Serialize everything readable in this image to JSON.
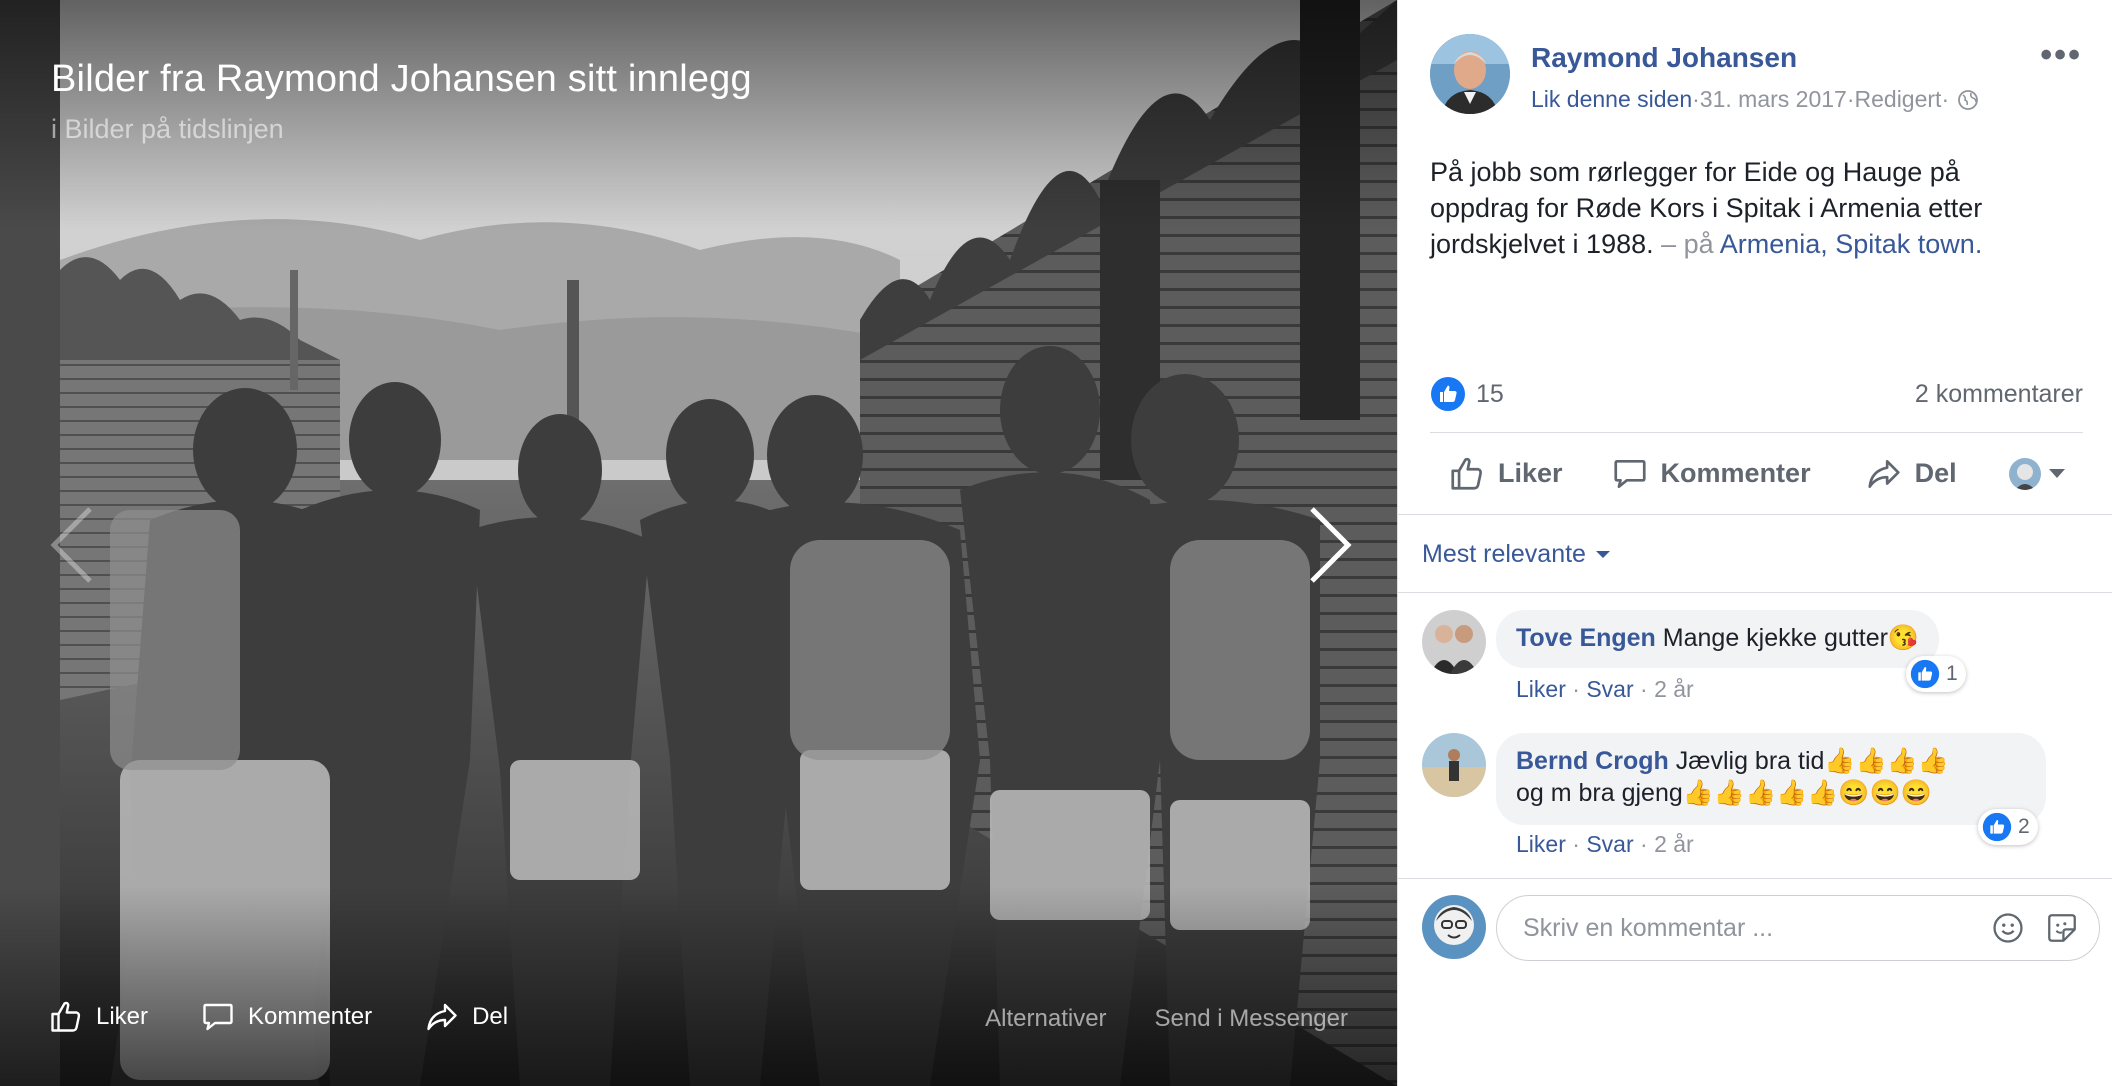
{
  "viewer": {
    "title": "Bilder fra Raymond Johansen sitt innlegg",
    "subtitle": "i Bilder på tidslinjen",
    "actions": {
      "like": "Liker",
      "comment": "Kommenter",
      "share": "Del"
    },
    "secondary": {
      "options": "Alternativer",
      "messenger": "Send i Messenger"
    }
  },
  "post": {
    "author": "Raymond Johansen",
    "like_page": "Lik denne siden",
    "meta_sep1": " · ",
    "date": "31. mars 2017",
    "meta_sep2": " · ",
    "edited": "Redigert",
    "meta_sep3": " · ",
    "more": "•••",
    "text": "På jobb som rørlegger for Eide og Hauge på oppdrag for Røde Kors i Spitak i Armenia etter jordskjelvet i 1988.",
    "location_prefix": " – på ",
    "location": "Armenia, Spitak town.",
    "like_count": "15",
    "comment_count": "2 kommentarer",
    "actions": {
      "like": "Liker",
      "comment": "Kommenter",
      "share": "Del"
    },
    "like_color": "#1877f2"
  },
  "comments_section": {
    "sort_label": "Mest relevante",
    "comments": [
      {
        "name": "Tove Engen",
        "text": "Mange kjekke gutter😘",
        "like_link": "Liker",
        "sep1": " · ",
        "reply_link": "Svar",
        "sep2": " · ",
        "age": "2 år",
        "reactions": "1"
      },
      {
        "name": "Bernd Crogh",
        "text_line1": "Jævlig bra tid👍👍👍👍",
        "text_line2": "og m bra gjeng👍👍👍👍👍😄😄😄",
        "like_link": "Liker",
        "sep1": " · ",
        "reply_link": "Svar",
        "sep2": " · ",
        "age": "2 år",
        "reactions": "2"
      }
    ],
    "composer_placeholder": "Skriv en kommentar ..."
  }
}
